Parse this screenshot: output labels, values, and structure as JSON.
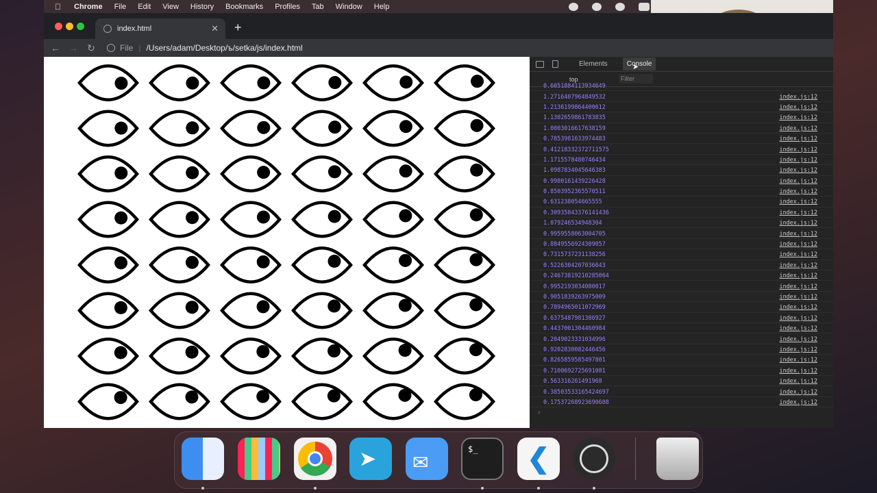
{
  "menubar": {
    "app": "Chrome",
    "items": [
      "File",
      "Edit",
      "View",
      "History",
      "Bookmarks",
      "Profiles",
      "Tab",
      "Window",
      "Help"
    ]
  },
  "browser": {
    "tab_title": "index.html",
    "new_tab_symbol": "+",
    "url_scheme": "File",
    "url": "/Users/adam/Desktop/ъ/setka/js/index.html"
  },
  "page": {
    "grid": {
      "columns": 6,
      "rows": 8
    },
    "pupil_look_target": "upper-right"
  },
  "devtools": {
    "tabs": [
      "Elements",
      "Console"
    ],
    "active_tab": "Console",
    "context": "top",
    "filter_placeholder": "Filter",
    "logs": [
      {
        "value": "0.6051884113934649",
        "source": "index.js:12"
      },
      {
        "value": "1.2716407964849532",
        "source": "index.js:12"
      },
      {
        "value": "1.2136199864400612",
        "source": "index.js:12"
      },
      {
        "value": "1.1302659861783835",
        "source": "index.js:12"
      },
      {
        "value": "1.0003016617638159",
        "source": "index.js:12"
      },
      {
        "value": "0.7853981633974483",
        "source": "index.js:12"
      },
      {
        "value": "0.41218332372711575",
        "source": "index.js:12"
      },
      {
        "value": "1.1715578480746434",
        "source": "index.js:12"
      },
      {
        "value": "1.0987834045646383",
        "source": "index.js:12"
      },
      {
        "value": "0.9980161439226428",
        "source": "index.js:12"
      },
      {
        "value": "0.8503952365570511",
        "source": "index.js:12"
      },
      {
        "value": "0.631238054665555",
        "source": "index.js:12"
      },
      {
        "value": "0.30935843376141436",
        "source": "index.js:12"
      },
      {
        "value": "1.079246534948304",
        "source": "index.js:12"
      },
      {
        "value": "0.9959558063004705",
        "source": "index.js:12"
      },
      {
        "value": "0.8849556924309057",
        "source": "index.js:12"
      },
      {
        "value": "0.7315737231138256",
        "source": "index.js:12"
      },
      {
        "value": "0.5226304207036643",
        "source": "index.js:12"
      },
      {
        "value": "0.24673819210285064",
        "source": "index.js:12"
      },
      {
        "value": "0.9952193034080017",
        "source": "index.js:12"
      },
      {
        "value": "0.9051839263975009",
        "source": "index.js:12"
      },
      {
        "value": "0.7894965011072969",
        "source": "index.js:12"
      },
      {
        "value": "0.6375487981386927",
        "source": "index.js:12"
      },
      {
        "value": "0.4437001304460984",
        "source": "index.js:12"
      },
      {
        "value": "0.2049023331034996",
        "source": "index.js:12"
      },
      {
        "value": "0.9202830082446456",
        "source": "index.js:12"
      },
      {
        "value": "0.8265859585497801",
        "source": "index.js:12"
      },
      {
        "value": "0.7100692725691081",
        "source": "index.js:12"
      },
      {
        "value": "0.563316261491968",
        "source": "index.js:12"
      },
      {
        "value": "0.38503533165424697",
        "source": "index.js:12"
      },
      {
        "value": "0.17537268923690608",
        "source": "index.js:12"
      }
    ],
    "prompt_symbol": "›"
  },
  "dock": {
    "apps": [
      {
        "name": "Finder",
        "color": "#3d8ef0"
      },
      {
        "name": "Launchpad",
        "color": "#d9d9d9"
      },
      {
        "name": "Google Chrome",
        "color": "#f1f1f1"
      },
      {
        "name": "Telegram",
        "color": "#2aa3dd"
      },
      {
        "name": "Mail",
        "color": "#4a9cf5"
      },
      {
        "name": "Terminal",
        "color": "#1e1e1e"
      },
      {
        "name": "Visual Studio Code",
        "color": "#f5f5f5"
      },
      {
        "name": "OBS",
        "color": "#2b2b2b"
      },
      {
        "name": "Trash",
        "color": "#c8c8c8"
      }
    ]
  },
  "colors": {
    "console_value": "#9980ff",
    "devtools_bg": "#242424",
    "browser_frame": "#202124"
  }
}
